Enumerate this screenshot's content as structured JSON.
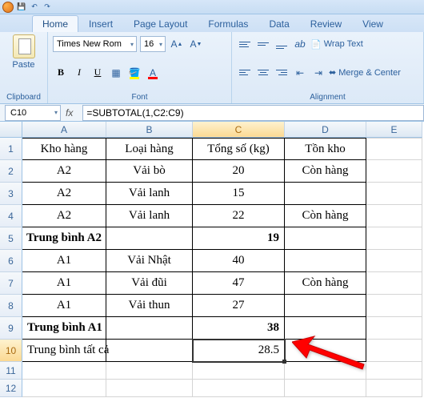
{
  "qat": {
    "save": "💾",
    "undo": "↶",
    "redo": "↷"
  },
  "tabs": [
    "Home",
    "Insert",
    "Page Layout",
    "Formulas",
    "Data",
    "Review",
    "View"
  ],
  "active_tab": 0,
  "ribbon": {
    "clipboard": {
      "paste": "Paste",
      "label": "Clipboard"
    },
    "font": {
      "name": "Times New Rom",
      "size": "16",
      "grow": "A▴",
      "shrink": "A▾",
      "bold": "B",
      "italic": "I",
      "underline": "U",
      "label": "Font"
    },
    "alignment": {
      "wrap": "Wrap Text",
      "merge": "Merge & Center",
      "label": "Alignment"
    }
  },
  "formula_bar": {
    "namebox": "C10",
    "fx": "fx",
    "formula": "=SUBTOTAL(1,C2:C9)"
  },
  "columns": [
    "A",
    "B",
    "C",
    "D",
    "E"
  ],
  "row_numbers": [
    "1",
    "2",
    "3",
    "4",
    "5",
    "6",
    "7",
    "8",
    "9",
    "10",
    "11",
    "12"
  ],
  "headers": {
    "A": "Kho hàng",
    "B": "Loại hàng",
    "C": "Tổng số (kg)",
    "D": "Tồn kho"
  },
  "data": [
    {
      "A": "A2",
      "B": "Vải bò",
      "C": "20",
      "D": "Còn hàng"
    },
    {
      "A": "A2",
      "B": "Vải lanh",
      "C": "15",
      "D": ""
    },
    {
      "A": "A2",
      "B": "Vải lanh",
      "C": "22",
      "D": "Còn hàng"
    },
    {
      "A": "Trung bình A2",
      "B": "",
      "C": "19",
      "D": "",
      "bold": true,
      "centerA": true
    },
    {
      "A": "A1",
      "B": "Vải Nhật",
      "C": "40",
      "D": ""
    },
    {
      "A": "A1",
      "B": "Vải đũi",
      "C": "47",
      "D": "Còn hàng"
    },
    {
      "A": "A1",
      "B": "Vải thun",
      "C": "27",
      "D": ""
    },
    {
      "A": "Trung bình A1",
      "B": "",
      "C": "38",
      "D": "",
      "bold": true,
      "leftA": true
    },
    {
      "A": "Trung bình tất cả",
      "B": "",
      "C": "28.5",
      "D": "",
      "leftA": true,
      "selectedC": true
    }
  ]
}
